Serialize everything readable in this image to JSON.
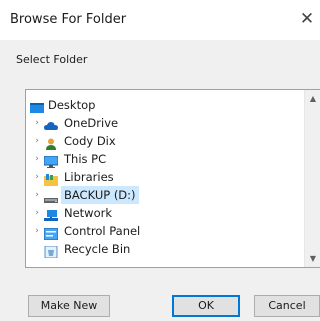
{
  "window": {
    "title": "Browse For Folder",
    "close_glyph": "✕"
  },
  "instruction": "Select Folder",
  "tree": {
    "items": [
      {
        "label": "Desktop",
        "icon": "desktop-icon",
        "expander": "",
        "root": true
      },
      {
        "label": "OneDrive",
        "icon": "cloud-icon",
        "expander": "›"
      },
      {
        "label": "Cody Dix",
        "icon": "user-icon",
        "expander": "›"
      },
      {
        "label": "This PC",
        "icon": "computer-icon",
        "expander": "›"
      },
      {
        "label": "Libraries",
        "icon": "libraries-icon",
        "expander": "›"
      },
      {
        "label": "BACKUP (D:)",
        "icon": "drive-icon",
        "expander": "›",
        "selected": true
      },
      {
        "label": "Network",
        "icon": "network-icon",
        "expander": "›"
      },
      {
        "label": "Control Panel",
        "icon": "control-panel-icon",
        "expander": "›"
      },
      {
        "label": "Recycle Bin",
        "icon": "recycle-bin-icon",
        "expander": ""
      }
    ]
  },
  "scrollbar": {
    "up_glyph": "▲",
    "down_glyph": "▼"
  },
  "buttons": {
    "make_new_folder": "Make New Folder",
    "ok": "OK",
    "cancel": "Cancel"
  },
  "colors": {
    "selection": "#cce8ff",
    "default_button_border": "#0078d7"
  }
}
